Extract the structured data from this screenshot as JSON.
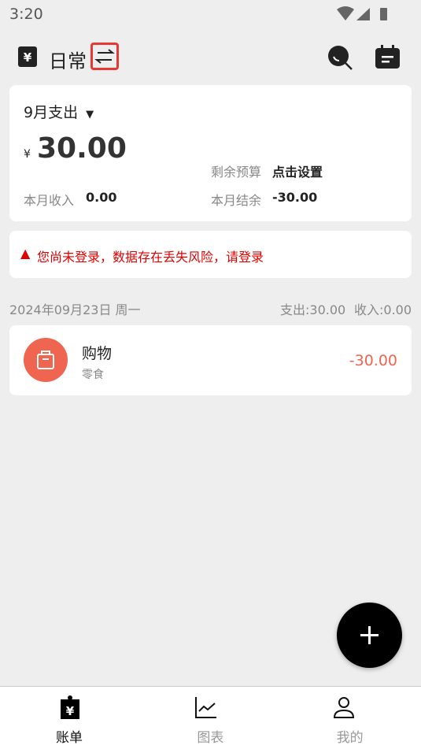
{
  "status": {
    "time": "3:20"
  },
  "header": {
    "title": "日常",
    "switch_icon": "swap-arrows-icon",
    "search_icon": "search-icon",
    "calendar_icon": "calendar-icon",
    "logo_icon": "yuan-book-icon"
  },
  "summary": {
    "month_label": "9月支出",
    "currency": "¥",
    "expense": "30.00",
    "budget_label": "剩余预算",
    "budget_value": "点击设置",
    "income_label": "本月收入",
    "income_value": "0.00",
    "balance_label": "本月结余",
    "balance_value": "-30.00"
  },
  "warning": {
    "text": "您尚未登录，数据存在丢失风险，请登录",
    "color": "#e00000"
  },
  "day": {
    "date": "2024年09月23日 周一",
    "expense": "支出:30.00",
    "income": "收入:0.00"
  },
  "records": [
    {
      "category": "购物",
      "note": "零食",
      "amount": "-30.00",
      "icon": "shopping-bag-icon",
      "color": "#f0654f"
    }
  ],
  "fab": {
    "icon": "plus-icon"
  },
  "nav": [
    {
      "label": "账单",
      "icon": "bill-icon",
      "active": true
    },
    {
      "label": "图表",
      "icon": "chart-icon"
    },
    {
      "label": "我的",
      "icon": "user-icon"
    }
  ]
}
